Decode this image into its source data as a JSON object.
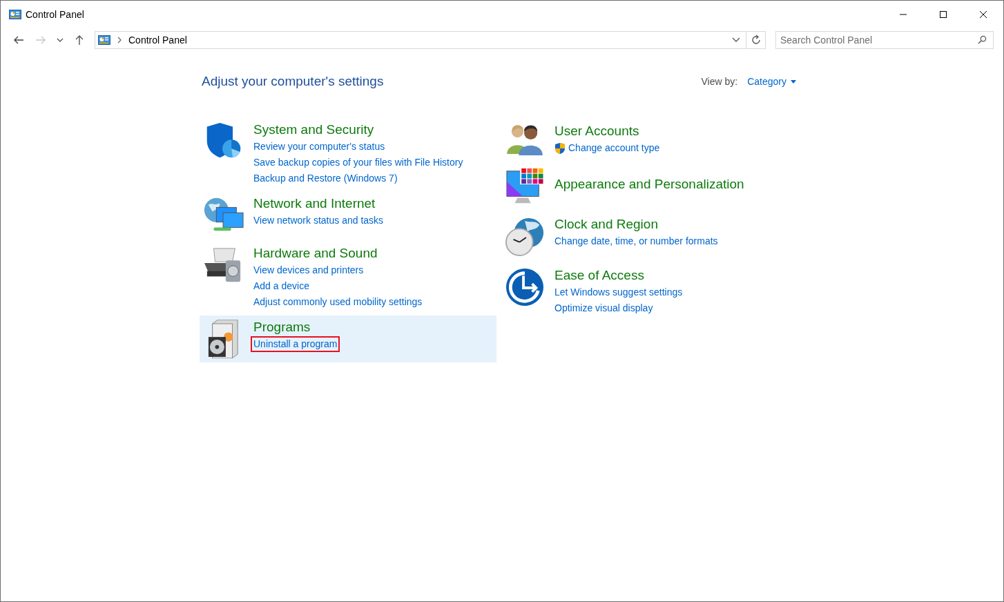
{
  "window": {
    "title": "Control Panel"
  },
  "address_bar": {
    "path": "Control Panel"
  },
  "search": {
    "placeholder": "Search Control Panel"
  },
  "heading": "Adjust your computer's settings",
  "view_by": {
    "label": "View by:",
    "value": "Category"
  },
  "columns": [
    {
      "categories": [
        {
          "kind": "security",
          "title": "System and Security",
          "selected": false,
          "links": [
            {
              "text": "Review your computer's status",
              "shield": false,
              "highlighted": false
            },
            {
              "text": "Save backup copies of your files with File History",
              "shield": false,
              "highlighted": false
            },
            {
              "text": "Backup and Restore (Windows 7)",
              "shield": false,
              "highlighted": false
            }
          ]
        },
        {
          "kind": "network",
          "title": "Network and Internet",
          "selected": false,
          "links": [
            {
              "text": "View network status and tasks",
              "shield": false,
              "highlighted": false
            }
          ]
        },
        {
          "kind": "hardware",
          "title": "Hardware and Sound",
          "selected": false,
          "links": [
            {
              "text": "View devices and printers",
              "shield": false,
              "highlighted": false
            },
            {
              "text": "Add a device",
              "shield": false,
              "highlighted": false
            },
            {
              "text": "Adjust commonly used mobility settings",
              "shield": false,
              "highlighted": false
            }
          ]
        },
        {
          "kind": "programs",
          "title": "Programs",
          "selected": true,
          "links": [
            {
              "text": "Uninstall a program",
              "shield": false,
              "highlighted": true
            }
          ]
        }
      ]
    },
    {
      "categories": [
        {
          "kind": "users",
          "title": "User Accounts",
          "selected": false,
          "links": [
            {
              "text": "Change account type",
              "shield": true,
              "highlighted": false
            }
          ]
        },
        {
          "kind": "appearance",
          "title": "Appearance and Personalization",
          "selected": false
        },
        {
          "kind": "clock",
          "title": "Clock and Region",
          "selected": false,
          "links": [
            {
              "text": "Change date, time, or number formats",
              "shield": false,
              "highlighted": false
            }
          ]
        },
        {
          "kind": "access",
          "title": "Ease of Access",
          "selected": false,
          "links": [
            {
              "text": "Let Windows suggest settings",
              "shield": false,
              "highlighted": false
            },
            {
              "text": "Optimize visual display",
              "shield": false,
              "highlighted": false
            }
          ]
        }
      ]
    }
  ]
}
